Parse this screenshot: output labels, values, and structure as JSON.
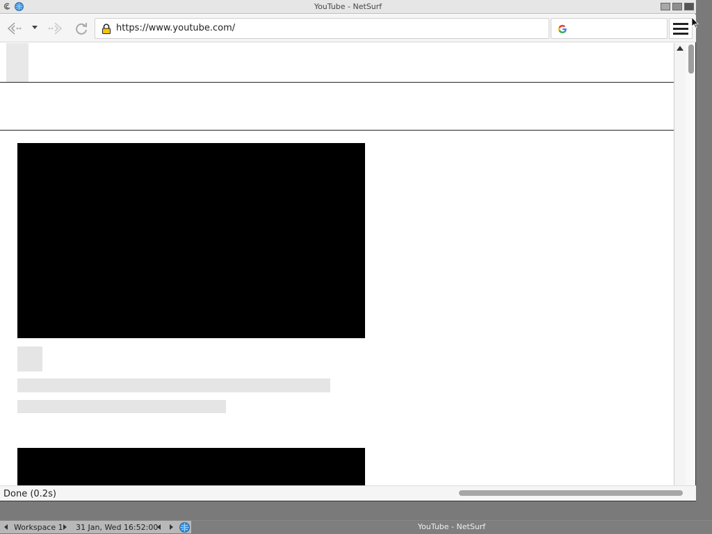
{
  "window": {
    "title": "YouTube - NetSurf"
  },
  "toolbar": {
    "url": "https://www.youtube.com/",
    "search_placeholder": ""
  },
  "statusbar": {
    "status": "Done (0.2s)"
  },
  "taskbar": {
    "workspace": "Workspace 1",
    "datetime": "31 Jan, Wed 16:52:00",
    "window_label": "YouTube - NetSurf"
  },
  "colors": {
    "video_placeholder": "#000000",
    "skeleton": "#e5e5e5",
    "google_blue": "#4285F4",
    "google_red": "#EA4335",
    "google_yellow": "#FBBC05",
    "google_green": "#34A853",
    "lock_yellow": "#f5c400"
  },
  "icons": {
    "back": "back-arrow-icon",
    "forward": "forward-arrow-icon",
    "reload": "reload-icon",
    "lock": "lock-icon",
    "search_engine": "google-g-icon",
    "menu": "hamburger-menu-icon"
  }
}
